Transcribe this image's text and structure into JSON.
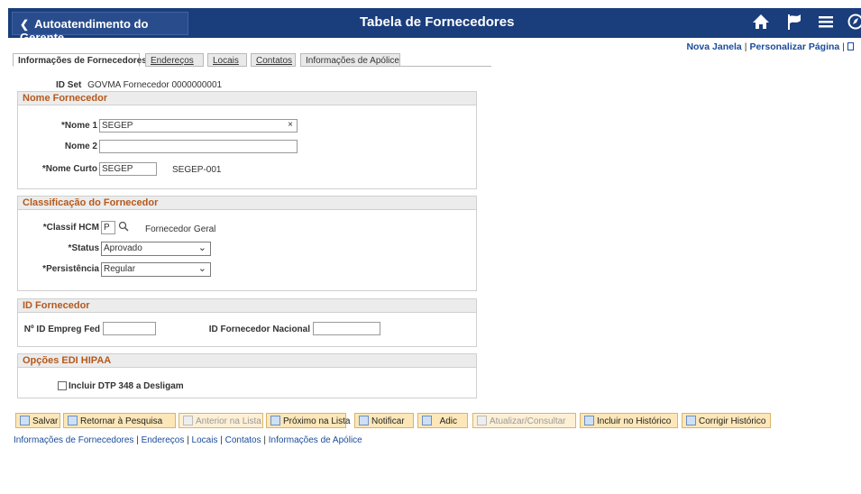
{
  "topbar": {
    "back_label": "Autoatendimento do Gerente",
    "title": "Tabela de Fornecedores",
    "icons": [
      "home-icon",
      "flag-icon",
      "menu-icon",
      "compass-icon"
    ]
  },
  "top_links": {
    "new_window": "Nova Janela",
    "personalize": "Personalizar Página"
  },
  "tabs": [
    {
      "label": "Informações de Fornecedores"
    },
    {
      "label": "Endereços"
    },
    {
      "label": "Locais"
    },
    {
      "label": "Contatos"
    },
    {
      "label": "Informações de Apólice"
    }
  ],
  "idset": {
    "label": "ID Set",
    "value": "GOVMA Fornecedor",
    "number": "0000000001"
  },
  "nome": {
    "header": "Nome Fornecedor",
    "nome1_label": "*Nome 1",
    "nome1_value": "SEGEP",
    "clear": "×",
    "nome2_label": "Nome 2",
    "nome2_value": "",
    "curto_label": "*Nome Curto",
    "curto_value": "SEGEP",
    "curto_desc": "SEGEP-001"
  },
  "classif": {
    "header": "Classificação do Fornecedor",
    "hcm_label": "*Classif HCM",
    "hcm_value": "P",
    "hcm_desc": "Fornecedor Geral",
    "status_label": "*Status",
    "status_value": "Aprovado",
    "persist_label": "*Persistência",
    "persist_value": "Regular"
  },
  "idforn": {
    "header": "ID Fornecedor",
    "emp_label": "Nº ID Empreg Fed",
    "emp_value": "",
    "nac_label": "ID Fornecedor Nacional",
    "nac_value": ""
  },
  "edi": {
    "header": "Opções EDI HIPAA",
    "dtp_label": "Incluir DTP 348 a Desligam"
  },
  "toolbar": {
    "save": "Salvar",
    "return": "Retornar à Pesquisa",
    "prev": "Anterior na Lista",
    "next": "Próximo na Lista",
    "notify": "Notificar",
    "add": "Adic",
    "update": "Atualizar/Consultar",
    "include": "Incluir no Histórico",
    "correct": "Corrigir Histórico"
  },
  "bottom_links": [
    "Informações de Fornecedores",
    "Endereços",
    "Locais",
    "Contatos",
    "Informações de Apólice"
  ],
  "colors": {
    "topbar": "#1a3d7c",
    "section_title": "#b5591c",
    "link": "#1a4b9b",
    "button": "#fde7b8"
  }
}
